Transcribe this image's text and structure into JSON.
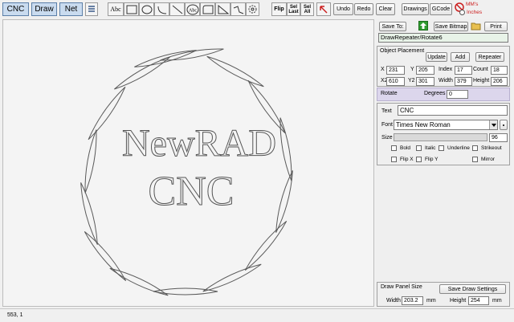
{
  "tabs": [
    "CNC",
    "Draw",
    "Net"
  ],
  "toolbar": {
    "abc": "Abc",
    "flip": "Flip",
    "sel_last": [
      "Sel",
      "Last"
    ],
    "sel_all": [
      "Sel",
      "All"
    ],
    "undo": "Undo",
    "redo": "Redo",
    "clear": "Clear",
    "drawings": "Drawings",
    "gcode": "GCode",
    "mms": "MM's",
    "inches": "Inches"
  },
  "canvas": {
    "line1": "NewRAD",
    "line2": "CNC"
  },
  "panel": {
    "save_to": "Save To:",
    "save_bitmap": "Save Bitmap",
    "print": "Print",
    "path": "DrawRepeater/Rotate6",
    "object_placement": "Object Placement",
    "update": "Update",
    "add": "Add",
    "repeater": "Repeater",
    "x_label": "X",
    "x": "231",
    "y_label": "Y",
    "y": "205",
    "index_label": "Index",
    "index": "17",
    "count_label": "Count",
    "count": "18",
    "x2_label": "X2",
    "x2": "610",
    "y2_label": "Y2",
    "y2": "301",
    "width_label": "Width",
    "width": "379",
    "height_label": "Height",
    "height": "206",
    "rotate": "Rotate",
    "degrees_label": "Degrees",
    "degrees": "0",
    "text_label": "Text",
    "text": "CNC",
    "font_label": "Font",
    "font": "Times New Roman",
    "size_label": "Size",
    "size": "96",
    "bold": "Bold",
    "italic": "Italic",
    "underline": "Underline",
    "strikeout": "Strikeout",
    "flip_x": "Flip X",
    "flip_y": "Flip Y",
    "mirror": "Mirror",
    "draw_panel_size": "Draw Panel Size",
    "save_draw_settings": "Save Draw Settings",
    "dp_width_label": "Width",
    "dp_width": "203.2",
    "dp_width_unit": "mm",
    "dp_height_label": "Height",
    "dp_height": "254",
    "dp_height_unit": "mm"
  },
  "status": "553, 1",
  "colors": {
    "active_tab": "#c9dbef",
    "rotate_bg": "#dcd6ec",
    "path_bg": "#e8f3e8",
    "green_arrow": "#2e9a2e",
    "red_icon": "#cc2020"
  }
}
